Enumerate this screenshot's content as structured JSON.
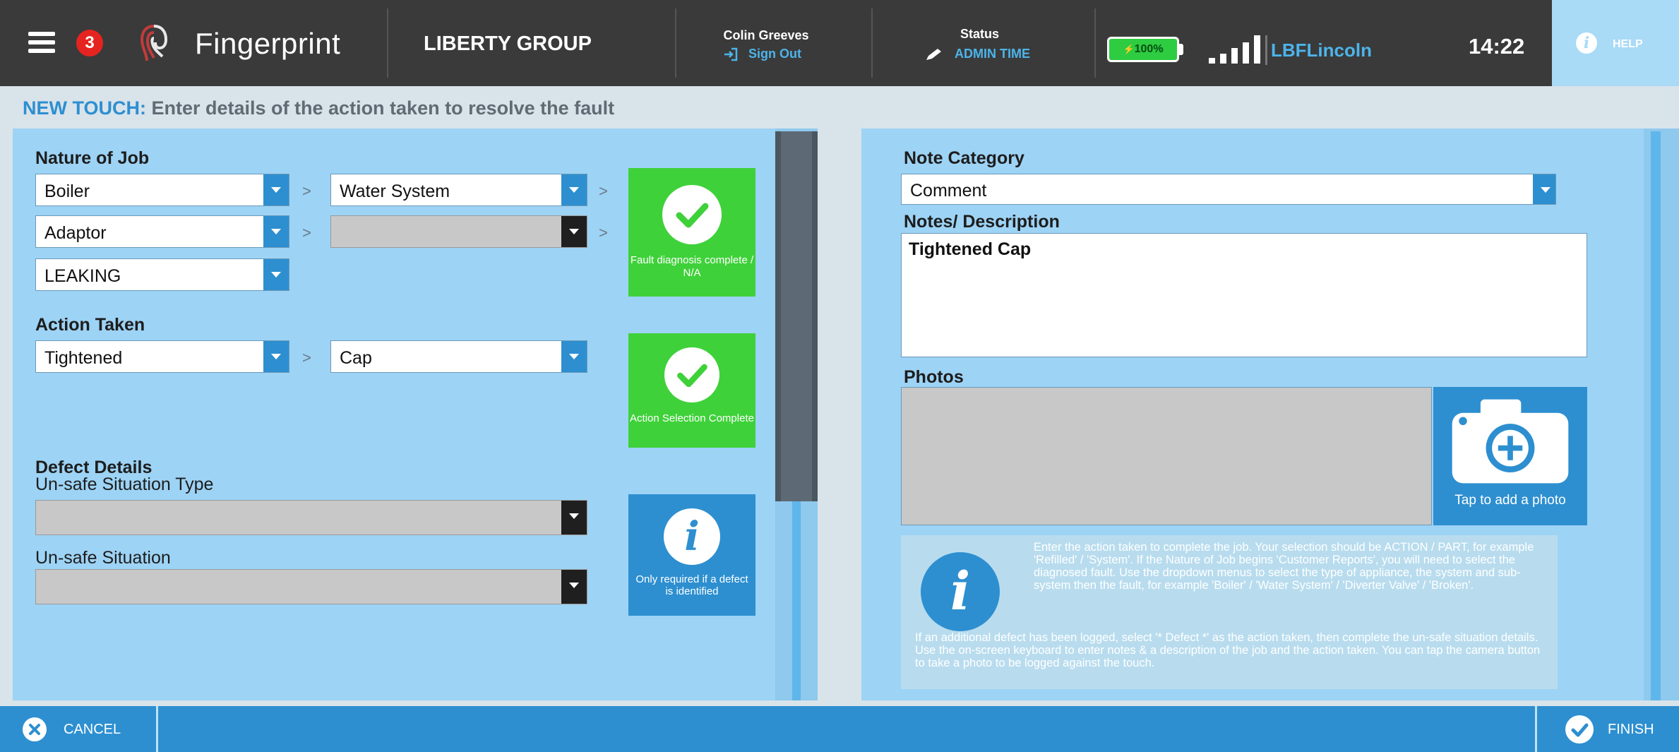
{
  "topbar": {
    "notification_count": "3",
    "logo_text": "Fingerprint",
    "company": "LIBERTY GROUP",
    "user_name": "Colin Greeves",
    "sign_out": "Sign Out",
    "status_label": "Status",
    "status_value": "ADMIN TIME",
    "battery": "100%",
    "network": "LBFLincoln",
    "clock": "14:22",
    "help": "HELP"
  },
  "page": {
    "title_accent": "NEW TOUCH:",
    "title_rest": " Enter details of the action taken to resolve the fault"
  },
  "nature_of_job": {
    "label": "Nature of Job",
    "appliance": "Boiler",
    "system": "Water System",
    "subsystem": "Adaptor",
    "component": "",
    "fault": "LEAKING",
    "separator": ">",
    "tile_caption": "Fault diagnosis complete / N/A"
  },
  "action_taken": {
    "label": "Action Taken",
    "action": "Tightened",
    "part": "Cap",
    "tile_caption": "Action Selection Complete"
  },
  "defect": {
    "label": "Defect Details",
    "type_label": "Un-safe Situation Type",
    "type_value": "",
    "situation_label": "Un-safe Situation",
    "situation_value": "",
    "tile_caption": "Only required if a defect is identified"
  },
  "notes": {
    "category_label": "Note Category",
    "category_value": "Comment",
    "description_label": "Notes/ Description",
    "description_value": "Tightened Cap"
  },
  "photos": {
    "label": "Photos",
    "add_caption": "Tap to add a photo"
  },
  "info": {
    "para1": "Enter the action taken to complete the job. Your selection should be ACTION / PART, for example 'Refilled' / 'System'. If the Nature of Job begins 'Customer Reports', you will need to select the diagnosed fault. Use the dropdown menus to select the type of appliance, the system and sub-system then the fault, for example 'Boiler' / 'Water System' / 'Diverter Valve' / 'Broken'.",
    "para2": "If an additional defect has been logged, select '* Defect *' as the action taken, then complete the un-safe situation details. Use the on-screen keyboard to enter notes & a description of the job and the action taken. You can tap the camera button to take a photo to be logged against the touch."
  },
  "footer": {
    "cancel": "CANCEL",
    "finish": "FINISH"
  },
  "colors": {
    "topbar": "#3a3a3a",
    "accent_blue": "#2d8fd0",
    "panel_blue": "#9dd3f5",
    "complete_green": "#3fd13a",
    "badge_red": "#e52420"
  },
  "icons": [
    "hamburger-icon",
    "fingerprint-logo-icon",
    "sign-out-icon",
    "pencil-icon",
    "battery-icon",
    "signal-icon",
    "info-icon",
    "check-icon",
    "camera-plus-icon",
    "cancel-icon",
    "finish-check-icon"
  ]
}
